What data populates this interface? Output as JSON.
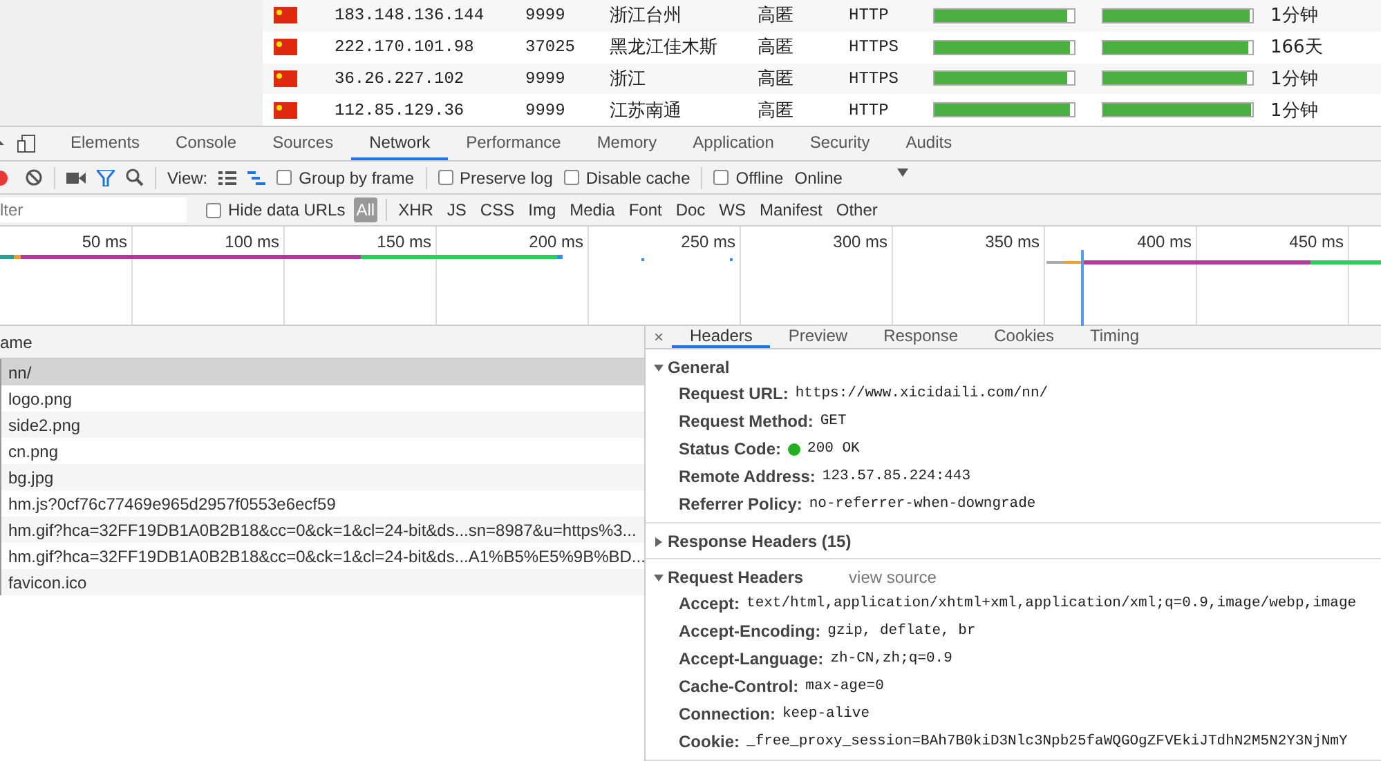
{
  "proxy_table": {
    "rows": [
      {
        "ip": "183.148.136.144",
        "port": "9999",
        "location": "浙江台州",
        "anonymity": "高匿",
        "type": "HTTP",
        "speed": {
          "level": 0.95
        },
        "connect": {
          "level": 0.98
        },
        "alive": "1分钟"
      },
      {
        "ip": "222.170.101.98",
        "port": "37025",
        "location": "黑龙江佳木斯",
        "anonymity": "高匿",
        "type": "HTTPS",
        "speed": {
          "level": 0.97
        },
        "connect": {
          "level": 0.97
        },
        "alive": "166天"
      },
      {
        "ip": "36.26.227.102",
        "port": "9999",
        "location": "浙江",
        "anonymity": "高匿",
        "type": "HTTPS",
        "speed": {
          "level": 0.95
        },
        "connect": {
          "level": 0.96
        },
        "alive": "1分钟"
      },
      {
        "ip": "112.85.129.36",
        "port": "9999",
        "location": "江苏南通",
        "anonymity": "高匿",
        "type": "HTTP",
        "speed": {
          "level": 0.97
        },
        "connect": {
          "level": 0.99
        },
        "alive": "1分钟"
      }
    ]
  },
  "devtools": {
    "tabs": [
      {
        "label": "Elements",
        "selected": false
      },
      {
        "label": "Console",
        "selected": false
      },
      {
        "label": "Sources",
        "selected": false
      },
      {
        "label": "Network",
        "selected": true
      },
      {
        "label": "Performance",
        "selected": false
      },
      {
        "label": "Memory",
        "selected": false
      },
      {
        "label": "Application",
        "selected": false
      },
      {
        "label": "Security",
        "selected": false
      },
      {
        "label": "Audits",
        "selected": false
      }
    ],
    "toolbar": {
      "recording": true,
      "view_label": "View:",
      "options": [
        {
          "label": "Group by frame",
          "checked": false
        },
        {
          "label": "Preserve log",
          "checked": false
        },
        {
          "label": "Disable cache",
          "checked": false
        },
        {
          "label": "Offline",
          "checked": false
        }
      ],
      "throttle": "Online"
    },
    "filter": {
      "placeholder": "lter",
      "hide_data_urls": {
        "label": "Hide data URLs",
        "checked": false
      },
      "types": [
        {
          "label": "All",
          "selected": true
        },
        {
          "label": "XHR",
          "selected": false
        },
        {
          "label": "JS",
          "selected": false
        },
        {
          "label": "CSS",
          "selected": false
        },
        {
          "label": "Img",
          "selected": false
        },
        {
          "label": "Media",
          "selected": false
        },
        {
          "label": "Font",
          "selected": false
        },
        {
          "label": "Doc",
          "selected": false
        },
        {
          "label": "WS",
          "selected": false
        },
        {
          "label": "Manifest",
          "selected": false
        },
        {
          "label": "Other",
          "selected": false
        }
      ]
    },
    "timeline": {
      "ticks": [
        "50 ms",
        "100 ms",
        "150 ms",
        "200 ms",
        "250 ms",
        "300 ms",
        "350 ms",
        "400 ms",
        "450 ms"
      ]
    },
    "requests": {
      "column": "ame",
      "rows": [
        {
          "name": "nn/",
          "selected": true
        },
        {
          "name": "logo.png",
          "selected": false
        },
        {
          "name": "side2.png",
          "selected": false
        },
        {
          "name": "cn.png",
          "selected": false
        },
        {
          "name": "bg.jpg",
          "selected": false
        },
        {
          "name": "hm.js?0cf76c77469e965d2957f0553e6ecf59",
          "selected": false
        },
        {
          "name": "hm.gif?hca=32FF19DB1A0B2B18&cc=0&ck=1&cl=24-bit&ds...sn=8987&u=https%3...",
          "selected": false
        },
        {
          "name": "hm.gif?hca=32FF19DB1A0B2B18&cc=0&ck=1&cl=24-bit&ds...A1%B5%E5%9B%BD...",
          "selected": false
        },
        {
          "name": "favicon.ico",
          "selected": false
        }
      ]
    },
    "detail": {
      "close": "×",
      "tabs": [
        {
          "label": "Headers",
          "selected": true
        },
        {
          "label": "Preview",
          "selected": false
        },
        {
          "label": "Response",
          "selected": false
        },
        {
          "label": "Cookies",
          "selected": false
        },
        {
          "label": "Timing",
          "selected": false
        }
      ],
      "sections": [
        {
          "title": "General",
          "expanded": true,
          "fields": [
            {
              "key": "Request URL:",
              "value": "https://www.xicidaili.com/nn/"
            },
            {
              "key": "Request Method:",
              "value": "GET"
            },
            {
              "key": "Status Code:",
              "value": "200 OK",
              "status_dot": true
            },
            {
              "key": "Remote Address:",
              "value": "123.57.85.224:443"
            },
            {
              "key": "Referrer Policy:",
              "value": "no-referrer-when-downgrade"
            }
          ]
        },
        {
          "title": "Response Headers (15)",
          "expanded": false
        },
        {
          "title": "Request Headers",
          "expanded": true,
          "link": "view source",
          "fields": [
            {
              "key": "Accept:",
              "value": "text/html,application/xhtml+xml,application/xml;q=0.9,image/webp,image"
            },
            {
              "key": "Accept-Encoding:",
              "value": "gzip, deflate, br"
            },
            {
              "key": "Accept-Language:",
              "value": "zh-CN,zh;q=0.9"
            },
            {
              "key": "Cache-Control:",
              "value": "max-age=0"
            },
            {
              "key": "Connection:",
              "value": "keep-alive"
            },
            {
              "key": "Cookie:",
              "value": "_free_proxy_session=BAh7B0kiD3Nlc3Npb25faWQGOgZFVEkiJTdhN2M5N2Y3NjNmY"
            }
          ]
        }
      ]
    }
  }
}
